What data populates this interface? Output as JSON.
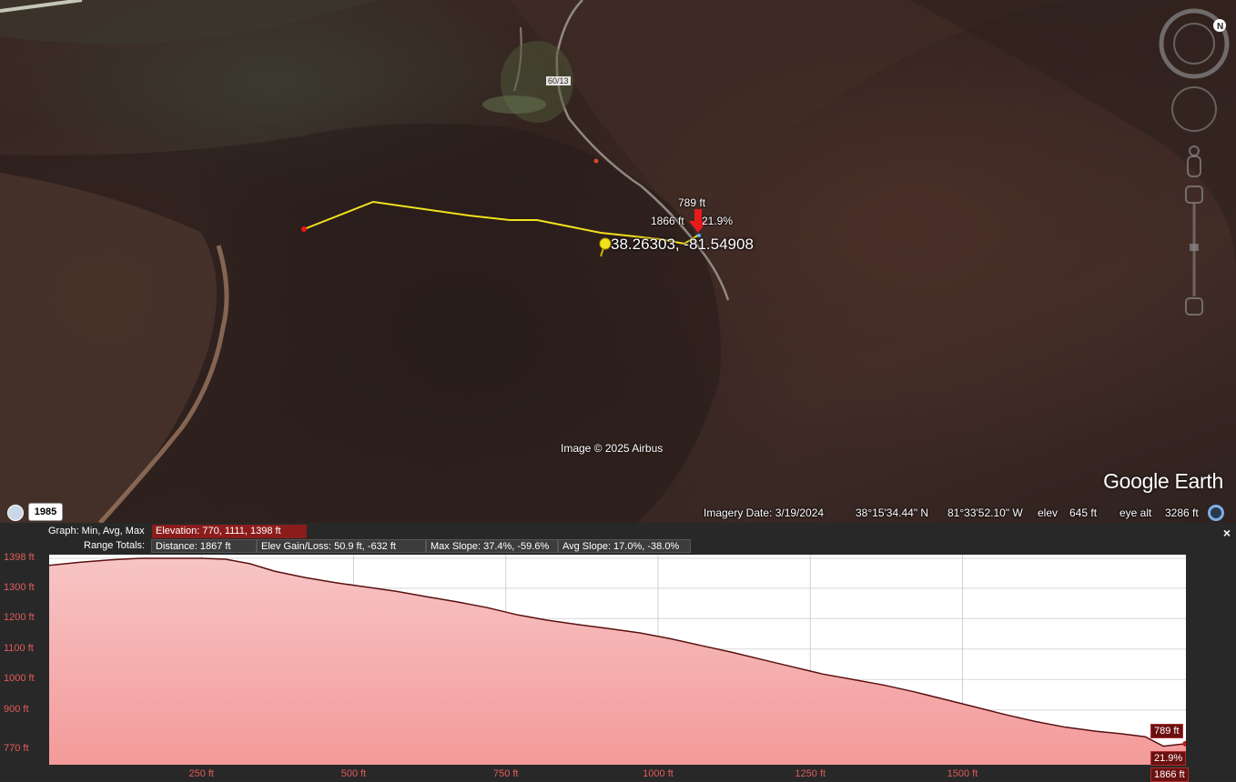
{
  "map": {
    "road_label": "60/13",
    "cursor_elevation": "789 ft",
    "cursor_distance": "1866 ft",
    "cursor_slope": "21.9%",
    "coordinates": "38.26303, -81.54908",
    "copyright": "Image © 2025 Airbus",
    "logo": "Google Earth",
    "path_color": "#f2e21e"
  },
  "nav": {
    "compass_icon": "compass-icon",
    "look_icon": "look-joystick-icon",
    "street_view_icon": "pegman-icon",
    "zoom_icon": "zoom-slider-icon"
  },
  "statusbar": {
    "historical_year": "1985",
    "imagery_date": "Imagery Date: 3/19/2024",
    "lat": "38°15'34.44\" N",
    "lon": "81°33'52.10\" W",
    "elev_label": "elev",
    "elev_value": "645 ft",
    "eye_alt_label": "eye alt",
    "eye_alt_value": "3286 ft"
  },
  "profile": {
    "graph_label": "Graph: Min, Avg, Max",
    "elevation_stats": "Elevation: 770, 1111, 1398 ft",
    "range_label": "Range Totals:",
    "distance": "Distance: 1867 ft",
    "elev_gain_loss": "Elev Gain/Loss: 50.9 ft, -632 ft",
    "max_slope": "Max Slope: 37.4%, -59.6%",
    "avg_slope": "Avg Slope: 17.0%, -38.0%",
    "close_label": "×",
    "cursor_elev_tag": "789 ft",
    "cursor_slope_tag": "21.9%",
    "cursor_dist_tag": "1866 ft"
  },
  "chart_data": {
    "type": "area",
    "title": "",
    "xlabel": "",
    "ylabel": "",
    "x_unit": "ft",
    "y_unit": "ft",
    "xlim": [
      0,
      1867
    ],
    "ylim": [
      720,
      1410
    ],
    "x_ticks": [
      "250 ft",
      "500 ft",
      "750 ft",
      "1000 ft",
      "1250 ft",
      "1500 ft"
    ],
    "x_tick_values": [
      250,
      500,
      750,
      1000,
      1250,
      1500
    ],
    "y_ticks": [
      "1398 ft",
      "1300 ft",
      "1200 ft",
      "1100 ft",
      "1000 ft",
      "900 ft",
      "770 ft"
    ],
    "y_tick_values": [
      1398,
      1300,
      1200,
      1100,
      1000,
      900,
      770
    ],
    "grid": true,
    "fill_color": "#f5a8a8",
    "line_color": "#5a1010",
    "series": [
      {
        "x": [
          0,
          50,
          100,
          150,
          200,
          250,
          290,
          330,
          370,
          420,
          470,
          520,
          570,
          620,
          670,
          720,
          770,
          820,
          870,
          920,
          970,
          1020,
          1070,
          1120,
          1170,
          1220,
          1270,
          1320,
          1370,
          1420,
          1470,
          1520,
          1570,
          1620,
          1670,
          1720,
          1760,
          1800,
          1830,
          1867
        ],
        "y": [
          1375,
          1385,
          1393,
          1398,
          1398,
          1398,
          1395,
          1380,
          1356,
          1335,
          1318,
          1304,
          1290,
          1272,
          1255,
          1236,
          1212,
          1194,
          1180,
          1167,
          1153,
          1134,
          1112,
          1090,
          1066,
          1042,
          1018,
          1000,
          982,
          960,
          935,
          910,
          885,
          862,
          843,
          830,
          822,
          812,
          781,
          789
        ]
      }
    ],
    "cursor": {
      "x": 1866,
      "y": 789,
      "slope": "21.9%"
    }
  }
}
